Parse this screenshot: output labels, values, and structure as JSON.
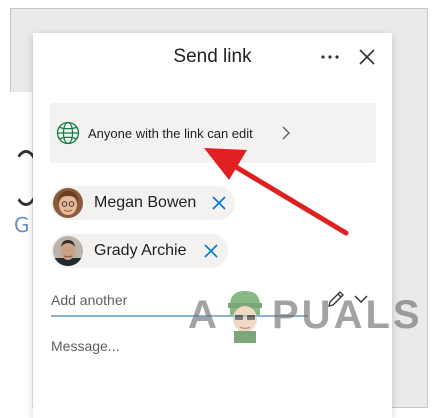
{
  "dialog": {
    "title": "Send link",
    "more_icon": "ellipsis-icon",
    "close_icon": "close-icon"
  },
  "link_settings": {
    "icon": "globe-icon",
    "label": "Anyone with the link can edit",
    "chevron": "chevron-right-icon"
  },
  "recipients": [
    {
      "name": "Megan Bowen",
      "remove_icon": "remove-x-icon"
    },
    {
      "name": "Grady Archie",
      "remove_icon": "remove-x-icon"
    }
  ],
  "add_field": {
    "placeholder": "Add another",
    "edit_icon": "pencil-icon",
    "dropdown_icon": "chevron-down-icon"
  },
  "message_field": {
    "placeholder": "Message..."
  },
  "watermark": {
    "first_letter": "A",
    "rest": "PUALS"
  },
  "colors": {
    "accent": "#0078d4",
    "globe": "#107c41",
    "chip_bg": "#f3f2f1",
    "arrow": "#e02020"
  }
}
